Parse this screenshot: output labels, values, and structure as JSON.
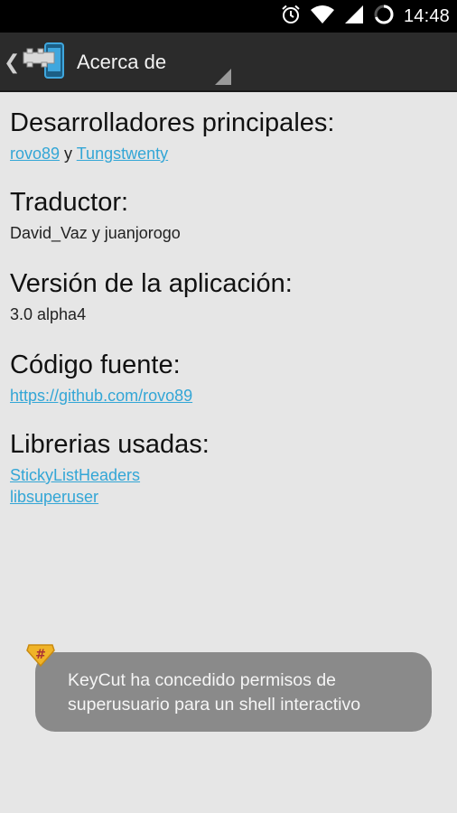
{
  "status_bar": {
    "time": "14:48",
    "icons": [
      "alarm-icon",
      "wifi-icon",
      "signal-icon",
      "battery-loading-icon"
    ]
  },
  "action_bar": {
    "title": "Acerca de",
    "app_icon": "keycut-app-icon"
  },
  "sections": {
    "developers": {
      "heading": "Desarrolladores principales:",
      "link1": "rovo89",
      "separator": " y ",
      "link2": "Tungstwenty"
    },
    "translator": {
      "heading": "Traductor:",
      "value": "David_Vaz y juanjorogo"
    },
    "version": {
      "heading": "Versión de la aplicación:",
      "value": "3.0 alpha4"
    },
    "source": {
      "heading": "Código fuente:",
      "link": "https://github.com/rovo89"
    },
    "libraries": {
      "heading": "Librerias usadas:",
      "items": [
        "StickyListHeaders",
        "libsuperuser"
      ]
    }
  },
  "toast": {
    "line1": "KeyCut ha concedido permisos de",
    "line2": "superusuario para un shell interactivo",
    "icon": "superuser-hash-icon"
  },
  "colors": {
    "link": "#33a6d6",
    "background": "#e6e6e6",
    "action_bar": "#2b2b2b",
    "toast": "#8a8a8a"
  }
}
